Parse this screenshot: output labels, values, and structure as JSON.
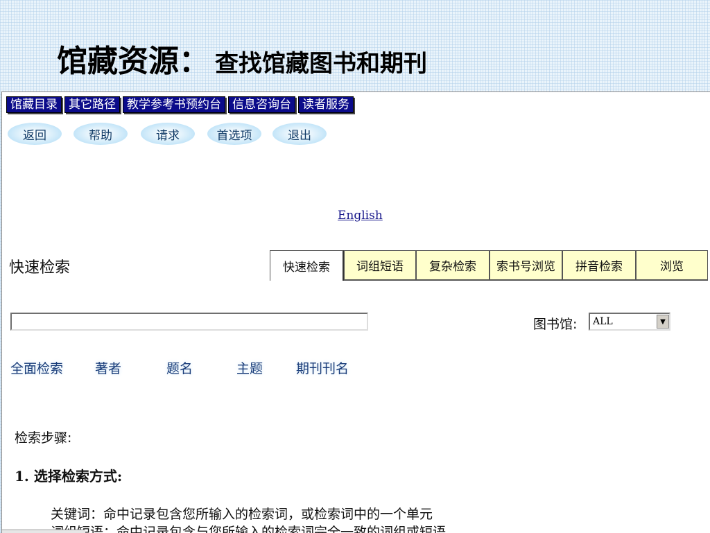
{
  "slide": {
    "title_main": "馆藏资源：",
    "title_sub": "查找馆藏图书和期刊"
  },
  "nav": [
    "馆藏目录",
    "其它路径",
    "教学参考书预约台",
    "信息咨询台",
    "读者服务"
  ],
  "buttons": [
    "返回",
    "帮助",
    "请求",
    "首选项",
    "退出"
  ],
  "english_link": "English",
  "search": {
    "title": "快速检索",
    "tabs": [
      "快速检索",
      "词组短语",
      "复杂检索",
      "索书号浏览",
      "拼音检索",
      "浏览"
    ],
    "active_tab": "快速检索",
    "input_value": "",
    "library_label": "图书馆:",
    "library_value": "ALL",
    "types": [
      "全面检索",
      "著者",
      "题名",
      "主题",
      "期刊刊名"
    ]
  },
  "steps": {
    "title": "检索步骤:",
    "step1": "1. 选择检索方式:",
    "desc_line1": "关键词：命中记录包含您所输入的检索词，或检索词中的一个单元",
    "desc_line2": "词组短语：命中记录包含与您所输入的检索词完全一致的词组或短语"
  },
  "colors": {
    "nav_bg": "#0b0b8a",
    "tab_bg": "#ffffcc",
    "link": "#1a1a8c"
  }
}
